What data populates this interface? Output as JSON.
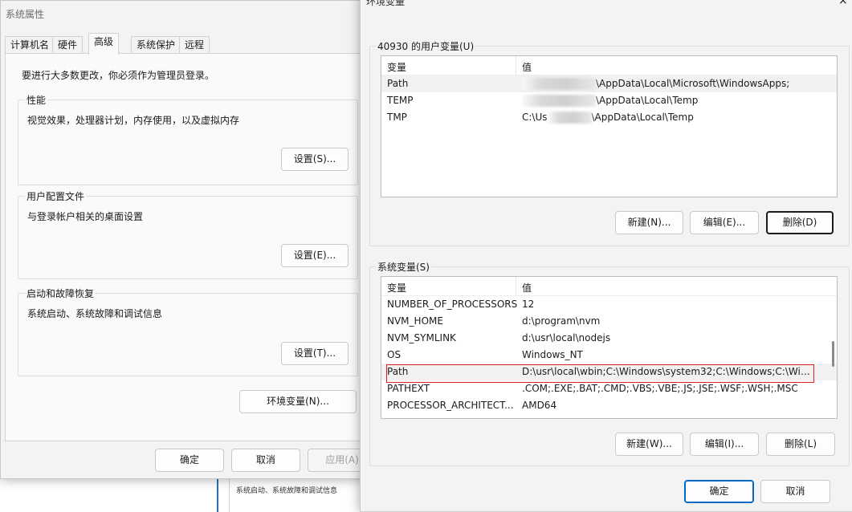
{
  "background": {
    "strip_text": "系统启动、系统故障和调试信息"
  },
  "sysprops": {
    "title": "系统属性",
    "tabs": [
      {
        "label": "计算机名"
      },
      {
        "label": "硬件"
      },
      {
        "label": "高级",
        "active": true
      },
      {
        "label": "系统保护"
      },
      {
        "label": "远程"
      }
    ],
    "notice": "要进行大多数更改，你必须作为管理员登录。",
    "performance": {
      "title": "性能",
      "desc": "视觉效果，处理器计划，内存使用，以及虚拟内存",
      "button": "设置(S)..."
    },
    "profiles": {
      "title": "用户配置文件",
      "desc": "与登录帐户相关的桌面设置",
      "button": "设置(E)..."
    },
    "startup": {
      "title": "启动和故障恢复",
      "desc": "系统启动、系统故障和调试信息",
      "button": "设置(T)..."
    },
    "env_button": "环境变量(N)...",
    "ok": "确定",
    "cancel": "取消",
    "apply": "应用(A)"
  },
  "envdlg": {
    "title": "环境变量",
    "close_glyph": "×",
    "user_group_title": "40930 的用户变量(U)",
    "columns": {
      "name": "变量",
      "value": "值"
    },
    "user_vars": [
      {
        "name": "Path",
        "value_prefix": "",
        "value": "\\AppData\\Local\\Microsoft\\WindowsApps;"
      },
      {
        "name": "TEMP",
        "value_prefix": "",
        "value": "\\AppData\\Local\\Temp"
      },
      {
        "name": "TMP",
        "value_prefix": "C:\\Us",
        "value": "\\AppData\\Local\\Temp"
      }
    ],
    "user_buttons": {
      "new": "新建(N)...",
      "edit": "编辑(E)...",
      "delete": "删除(D)"
    },
    "sys_group_title": "系统变量(S)",
    "sys_vars": [
      {
        "name": "NUMBER_OF_PROCESSORS",
        "value": "12"
      },
      {
        "name": "NVM_HOME",
        "value": "d:\\program\\nvm"
      },
      {
        "name": "NVM_SYMLINK",
        "value": "d:\\usr\\local\\nodejs"
      },
      {
        "name": "OS",
        "value": "Windows_NT"
      },
      {
        "name": "Path",
        "value": "D:\\usr\\local\\wbin;C:\\Windows\\system32;C:\\Windows;C:\\Wind..."
      },
      {
        "name": "PATHEXT",
        "value": ".COM;.EXE;.BAT;.CMD;.VBS;.VBE;.JS;.JSE;.WSF;.WSH;.MSC"
      },
      {
        "name": "PROCESSOR_ARCHITECT...",
        "value": "AMD64"
      }
    ],
    "sys_buttons": {
      "new": "新建(W)...",
      "edit": "编辑(I)...",
      "delete": "删除(L)"
    },
    "ok": "确定",
    "cancel": "取消"
  }
}
